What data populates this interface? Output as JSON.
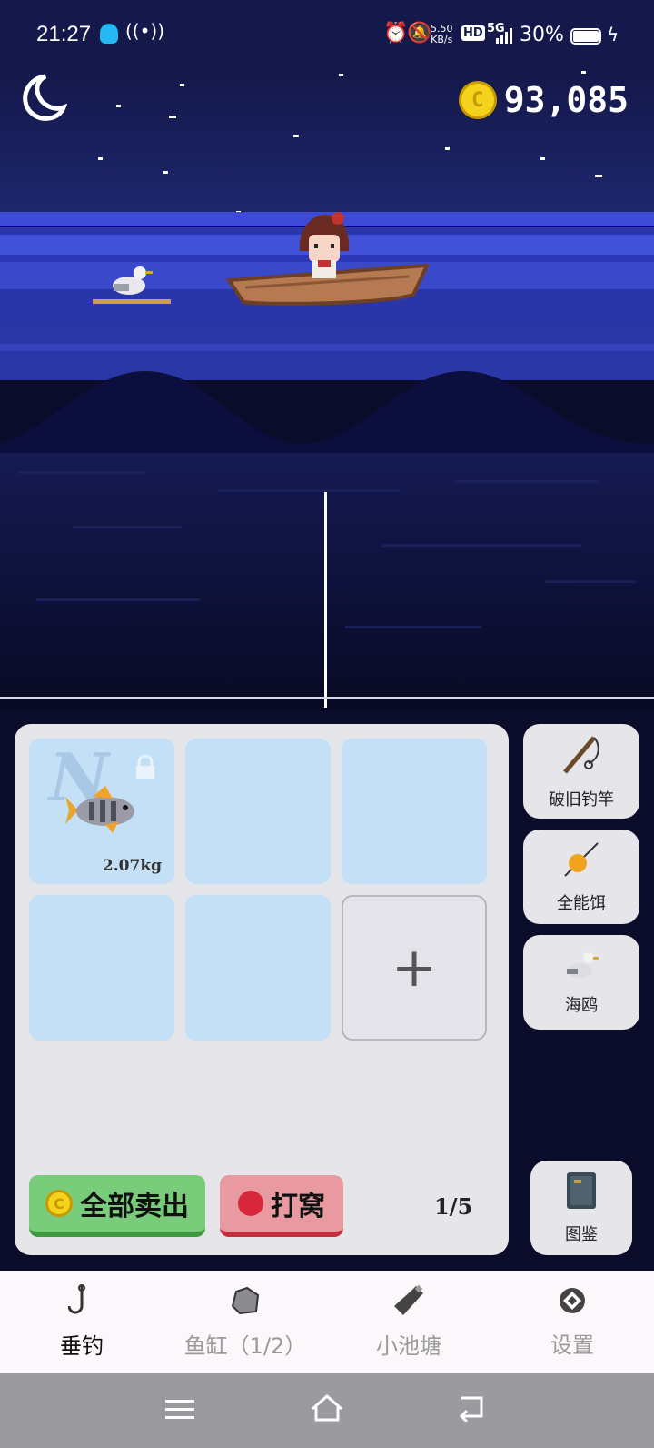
{
  "status_bar": {
    "time": "21:27",
    "net_speed_value": "5.50",
    "net_speed_unit": "KB/s",
    "hd": "HD",
    "signal": "5G",
    "battery": "30%"
  },
  "game": {
    "coins": "93,085",
    "coin_symbol": "C"
  },
  "inventory": {
    "slots": [
      {
        "weight": "2.07kg",
        "rarity": "N",
        "filled": true,
        "locked": true
      },
      {
        "filled": false
      },
      {
        "filled": false
      },
      {
        "filled": false
      },
      {
        "filled": false
      }
    ],
    "add_symbol": "+",
    "sell_all_label": "全部卖出",
    "chum_label": "打窝",
    "capacity": "1/5"
  },
  "equipment": [
    {
      "label": "破旧钓竿",
      "icon": "fishing-rod-icon"
    },
    {
      "label": "全能饵",
      "icon": "bait-icon"
    },
    {
      "label": "海鸥",
      "icon": "seagull-icon"
    }
  ],
  "encyclopedia": {
    "label": "图鉴",
    "icon": "book-icon"
  },
  "nav": [
    {
      "label": "垂钓",
      "icon": "hook-icon",
      "active": true
    },
    {
      "label": "鱼缸（1/2）",
      "icon": "rock-icon",
      "active": false
    },
    {
      "label": "小池塘",
      "icon": "bottle-icon",
      "active": false
    },
    {
      "label": "设置",
      "icon": "settings-icon",
      "active": false
    }
  ],
  "colors": {
    "sky": "#14184a",
    "sea_far": "#3b4bd6",
    "sea_deep": "#0a0d35",
    "panel": "#e5e5ea",
    "slot": "#c3e0f7",
    "sell_button": "#79cc79",
    "chum_button": "#e89aa0"
  }
}
